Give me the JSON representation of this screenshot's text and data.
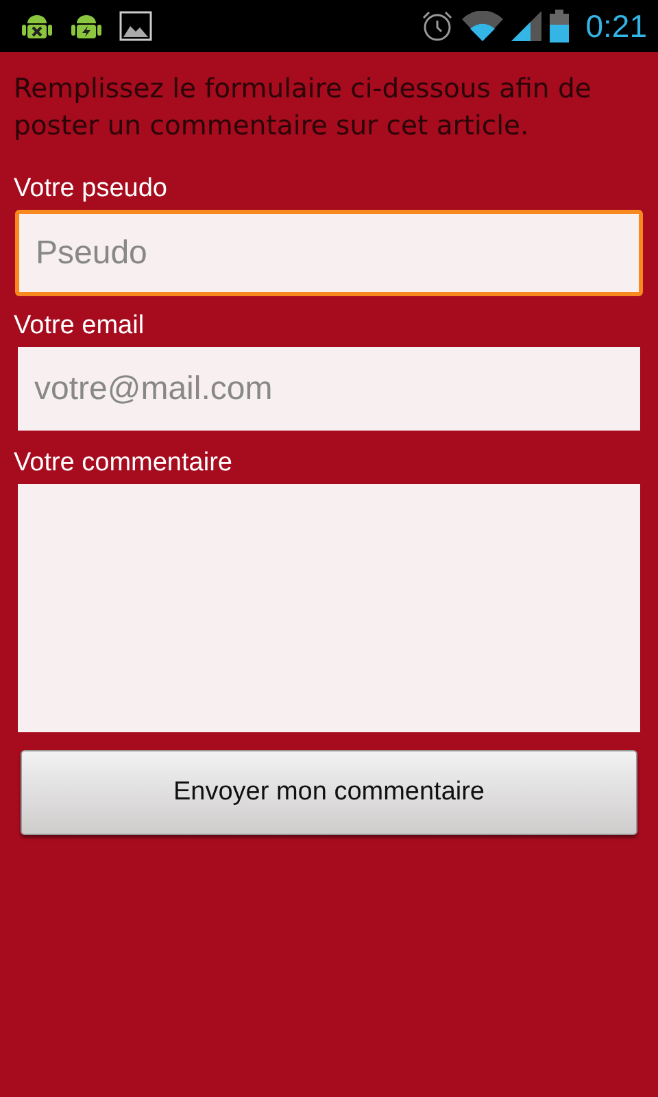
{
  "status_bar": {
    "time": "0:21"
  },
  "intro": "Remplissez le formulaire ci-dessous afin de poster un commentaire sur cet article.",
  "fields": [
    {
      "kind": "line",
      "label": "Votre pseudo",
      "placeholder": "Pseudo",
      "focused": true
    },
    {
      "kind": "line",
      "label": "Votre email",
      "placeholder": "votre@mail.com",
      "focused": false
    },
    {
      "kind": "multiline",
      "label": "Votre commentaire",
      "focused": false
    }
  ],
  "submit_button": "Envoyer mon commentaire"
}
